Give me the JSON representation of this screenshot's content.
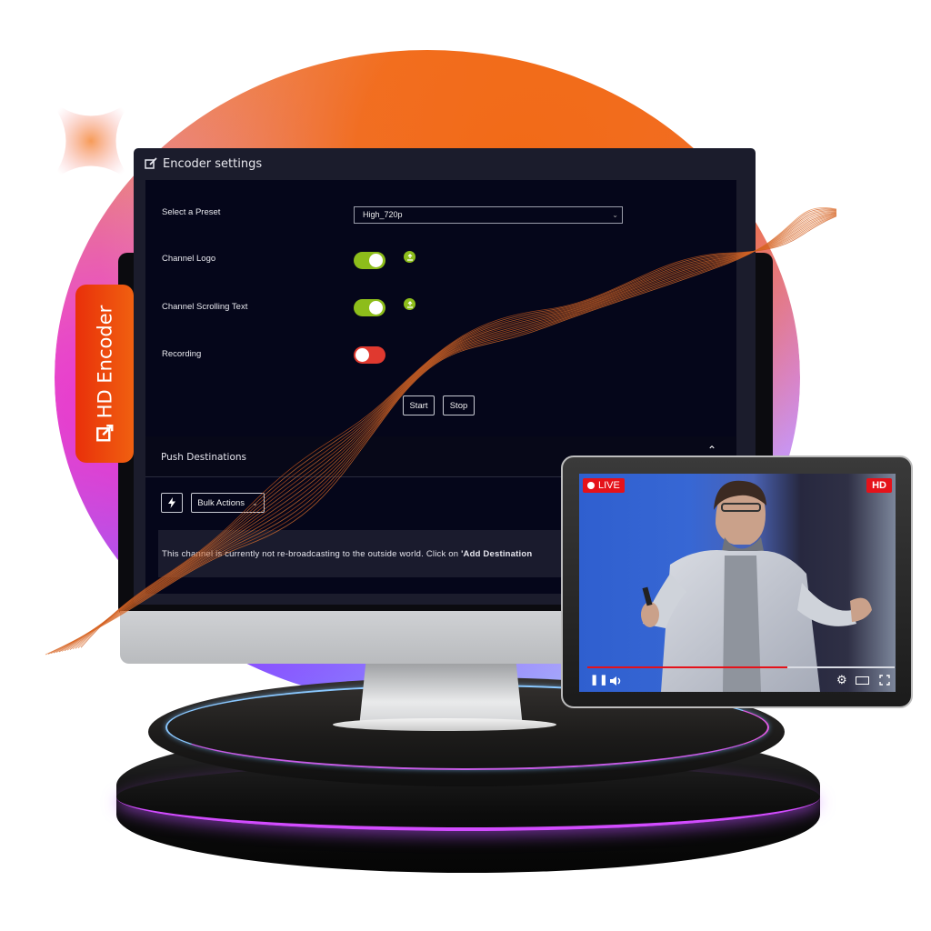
{
  "brand_badge": {
    "label": "HD Encoder",
    "icon": "external-edit-icon",
    "color": "#ef4d0e"
  },
  "app": {
    "title": "Encoder settings",
    "title_icon": "edit-icon",
    "preset": {
      "label": "Select a Preset",
      "value": "High_720p"
    },
    "toggles": [
      {
        "label": "Channel Logo",
        "state": "on",
        "has_upload": true
      },
      {
        "label": "Channel Scrolling Text",
        "state": "on",
        "has_upload": true
      },
      {
        "label": "Recording",
        "state": "off",
        "has_upload": false
      }
    ],
    "buttons": {
      "start": "Start",
      "stop": "Stop"
    },
    "push_destinations": {
      "title": "Push Destinations",
      "bulk_actions": "Bulk Actions",
      "info_prefix": "This channel is currently not re-broadcasting to the outside world. Click on ",
      "info_bold": "'Add Destination"
    },
    "colors": {
      "toggle_on": "#8dbd1b",
      "toggle_off": "#e0392f",
      "panel_bg": "#05061a"
    }
  },
  "player": {
    "live_label": "LIVE",
    "quality_label": "HD",
    "progress": 0.65,
    "controls": [
      "pause-icon",
      "volume-icon",
      "settings-icon",
      "theater-mode-icon",
      "fullscreen-icon"
    ],
    "accent": "#e5121a"
  }
}
